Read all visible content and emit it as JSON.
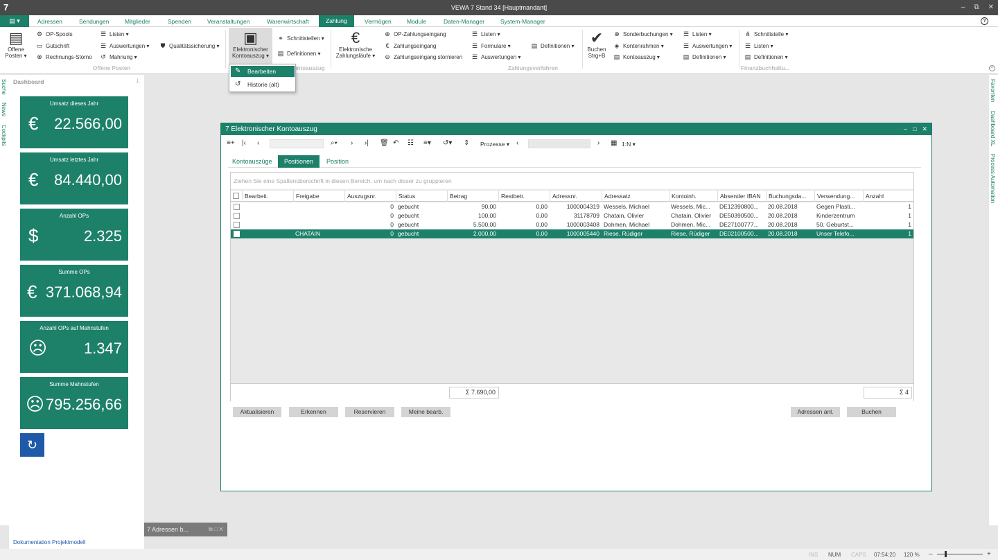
{
  "app": {
    "logo": "7",
    "title": "VEWA 7 Stand 34 [Hauptmandant]",
    "win_controls": [
      "–",
      "⧉",
      "✕"
    ]
  },
  "menu": {
    "app_button": "▤ ▾",
    "items": [
      "Adressen",
      "Sendungen",
      "Mitglieder",
      "Spenden",
      "Veranstaltungen",
      "Warenwirtschaft",
      "Zahlung",
      "Vermögen",
      "Module",
      "Daten-Manager",
      "System-Manager"
    ],
    "active": "Zahlung",
    "help": "?"
  },
  "ribbon": {
    "offene_posten": {
      "label1": "Offene",
      "label2": "Posten ▾",
      "op_spools": "OP-Spools",
      "gutschrift": "Gutschrift",
      "storno": "Rechnungs-Storno",
      "listen": "Listen ▾",
      "auswertungen": "Auswertungen ▾",
      "mahnung": "Mahnung ▾",
      "qualitaet": "Qualitätssicherung ▾",
      "group": "Offene Posten"
    },
    "kontoauszug": {
      "label1": "Elektronischer",
      "label2": "Kontoauszug ▾",
      "schnittstellen": "Schnittstellen ▾",
      "definitionen": "Definitionen ▾",
      "group": "Kontoauszug"
    },
    "zahlungsverfahren": {
      "label1": "Elektronische",
      "label2": "Zahlungsläufe ▾",
      "op_eingang": "OP-Zahlungseingang",
      "eingang": "Zahlungseingang",
      "storno": "Zahlungseingang stornieren",
      "listen": "Listen ▾",
      "formulare": "Formulare ▾",
      "auswertungen": "Auswertungen ▾",
      "definitionen": "Definitionen ▾",
      "group": "Zahlungsverfahren"
    },
    "fibu": {
      "label1": "Buchen",
      "label2": "Strg+B",
      "sonder": "Sonderbuchungen ▾",
      "kontenrahmen": "Kontenrahmen ▾",
      "kontoauszug": "Kontoauszug ▾",
      "listen": "Listen ▾",
      "auswertungen": "Auswertungen ▾",
      "definitionen": "Definitionen ▾",
      "schnittstelle": "Schnittstelle ▾",
      "listen2": "Listen ▾",
      "definitionen2": "Definitionen ▾",
      "group": "Finanzbuchhaltu..."
    }
  },
  "dropdown": {
    "items": [
      "Bearbeiten",
      "Historie (alt)"
    ]
  },
  "left_strip": [
    "Suche",
    "News",
    "Cockpits"
  ],
  "right_strip": [
    "Favoriten",
    "Dashboard XL",
    "Process Automation"
  ],
  "dashboard": {
    "title": "Dashboard",
    "pin": "⊥",
    "tiles": [
      {
        "label": "Umsatz dieses Jahr",
        "symbol": "€",
        "value": "22.566,00"
      },
      {
        "label": "Umsatz letztes Jahr",
        "symbol": "€",
        "value": "84.440,00"
      },
      {
        "label": "Anzahl OPs",
        "symbol": "$",
        "value": "2.325"
      },
      {
        "label": "Summe OPs",
        "symbol": "€",
        "value": "371.068,94"
      },
      {
        "label": "Anzahl OPs auf Mahnstufen",
        "symbol": "☹",
        "value": "1.347"
      },
      {
        "label": "Summe Mahnstufen",
        "symbol": "☹",
        "value": "795.256,66"
      }
    ],
    "refresh_icon": "↻",
    "doc_link": "Dokumentation Projektmodell"
  },
  "window": {
    "title": "Elektronischer Kontoauszug",
    "controls": [
      "–",
      "□",
      "✕"
    ],
    "toolbar": {
      "prozesse": "Prozesse ▾",
      "view": "1:N ▾"
    },
    "tabs": [
      "Kontoauszüge",
      "Positionen",
      "Position"
    ],
    "active_tab": "Positionen",
    "group_hint": "Ziehen Sie eine Spaltenüberschrift in diesen Bereich, um nach dieser zu gruppieren",
    "columns": [
      "Bearbeit.",
      "Freigabe",
      "Auszugsnr.",
      "Status",
      "Betrag",
      "Restbetr.",
      "Adressnr.",
      "Adressatz",
      "Kontoinh.",
      "Absender IBAN",
      "Buchungsda...",
      "Verwendung...",
      "Anzahl"
    ],
    "rows": [
      {
        "bearbeit": "",
        "freigabe": "",
        "auszugsnr": "0",
        "status": "gebucht",
        "betrag": "90,00",
        "restbetr": "0,00",
        "adressnr": "1000004319",
        "adressatz": "Wessels, Michael",
        "kontoinh": "Wessels, Mic...",
        "iban": "DE12390800...",
        "datum": "20.08.2018",
        "verwendung": "Gegen Plasti...",
        "anzahl": "1"
      },
      {
        "bearbeit": "",
        "freigabe": "",
        "auszugsnr": "0",
        "status": "gebucht",
        "betrag": "100,00",
        "restbetr": "0,00",
        "adressnr": "31178709",
        "adressatz": "Chatain, Olivier",
        "kontoinh": "Chatain, Olivier",
        "iban": "DE50390500...",
        "datum": "20.08.2018",
        "verwendung": "Kinderzentrum",
        "anzahl": "1"
      },
      {
        "bearbeit": "",
        "freigabe": "",
        "auszugsnr": "0",
        "status": "gebucht",
        "betrag": "5.500,00",
        "restbetr": "0,00",
        "adressnr": "1000003408",
        "adressatz": "Dohmen, Michael",
        "kontoinh": "Dohmen, Mic...",
        "iban": "DE27100777...",
        "datum": "20.08.2018",
        "verwendung": "50. Geburtst...",
        "anzahl": "1"
      },
      {
        "bearbeit": "",
        "freigabe": "CHATAIN",
        "auszugsnr": "0",
        "status": "gebucht",
        "betrag": "2.000,00",
        "restbetr": "0,00",
        "adressnr": "1000005440",
        "adressatz": "Riese, Rüdiger",
        "kontoinh": "Riese, Rüdiger",
        "iban": "DE02100500...",
        "datum": "20.08.2018",
        "verwendung": "Unser Telefo...",
        "anzahl": "1"
      }
    ],
    "selected_row": 3,
    "sum_betrag": "Σ 7.690,00",
    "sum_anzahl": "Σ 4",
    "buttons": [
      "Aktualisieren",
      "Erkennen",
      "Reservieren",
      "Meine bearb.",
      "Adressen anl.",
      "Buchen"
    ]
  },
  "minimized": {
    "title": "Adressen b...",
    "controls": "⧉ □ ✕"
  },
  "status": {
    "ins": "INS",
    "num": "NUM",
    "caps": "CAPS",
    "time": "07:54:20",
    "zoom": "120 %",
    "minus": "–",
    "plus": "+"
  }
}
